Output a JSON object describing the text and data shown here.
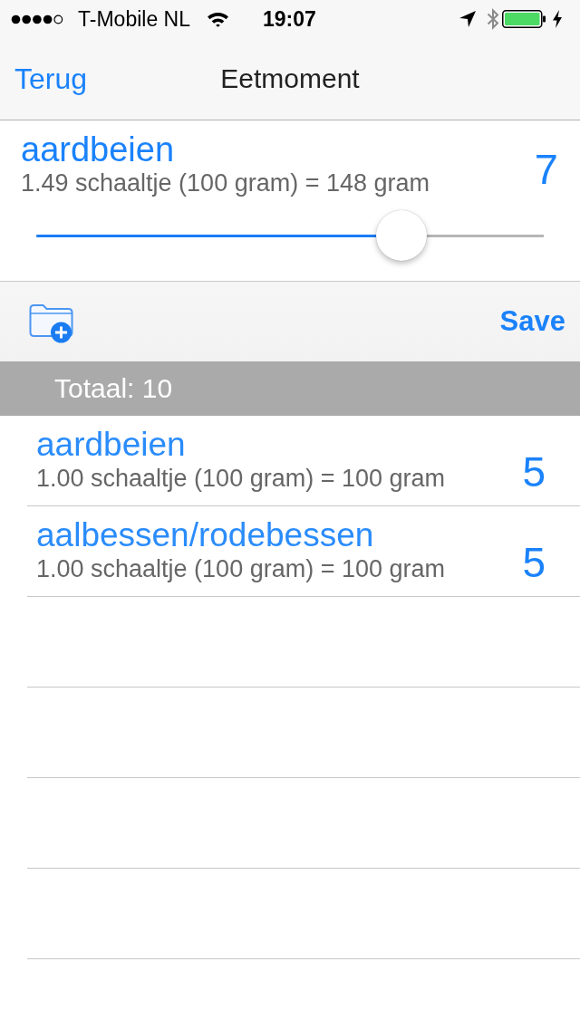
{
  "status_bar": {
    "carrier": "T-Mobile NL",
    "time": "19:07"
  },
  "nav_bar": {
    "back": "Terug",
    "title": "Eetmoment"
  },
  "detail": {
    "name": "aardbeien",
    "portion": "1.49 schaaltje (100 gram) = 148 gram",
    "value": "7",
    "slider": {
      "level": 0.72
    }
  },
  "toolbar": {
    "save": "Save"
  },
  "section": {
    "title": "Totaal: 10"
  },
  "items": [
    {
      "name": "aardbeien",
      "portion": "1.00 schaaltje (100 gram) = 100 gram",
      "value": "5"
    },
    {
      "name": "aalbessen/rodebessen",
      "portion": "1.00 schaaltje (100 gram) = 100 gram",
      "value": "5"
    }
  ]
}
